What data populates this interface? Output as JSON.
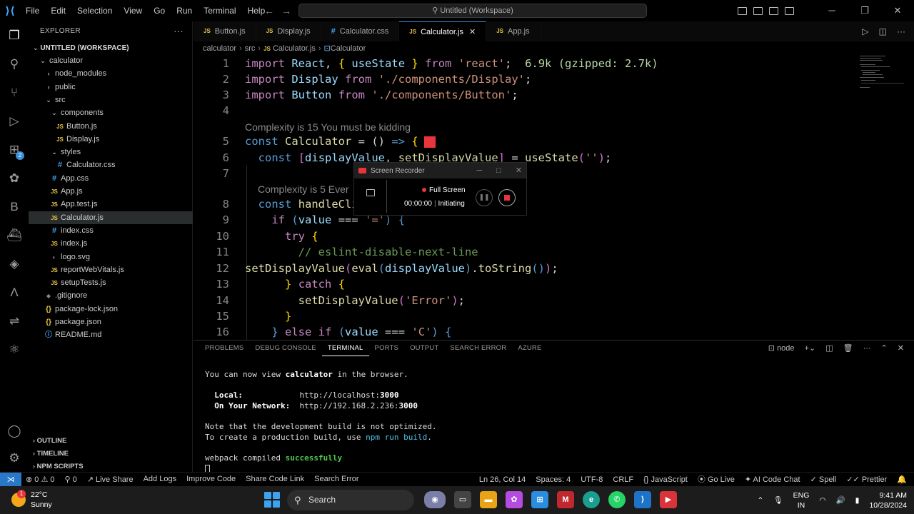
{
  "titlebar": {
    "menus": [
      "File",
      "Edit",
      "Selection",
      "View",
      "Go",
      "Run",
      "Terminal",
      "Help"
    ],
    "search": "Untitled (Workspace)"
  },
  "explorer": {
    "title": "EXPLORER",
    "workspace": "UNTITLED (WORKSPACE)",
    "items": [
      {
        "label": "calculator",
        "icon": "chevron-down",
        "depth": 1
      },
      {
        "label": "node_modules",
        "icon": "chevron-right",
        "depth": 2
      },
      {
        "label": "public",
        "icon": "chevron-right",
        "depth": 2
      },
      {
        "label": "src",
        "icon": "chevron-down",
        "depth": 2
      },
      {
        "label": "components",
        "icon": "chevron-down",
        "depth": 3
      },
      {
        "label": "Button.js",
        "icon": "js",
        "depth": 4
      },
      {
        "label": "Display.js",
        "icon": "js",
        "depth": 4
      },
      {
        "label": "styles",
        "icon": "chevron-down",
        "depth": 3
      },
      {
        "label": "Calculator.css",
        "icon": "css",
        "depth": 4
      },
      {
        "label": "App.css",
        "icon": "css",
        "depth": 3
      },
      {
        "label": "App.js",
        "icon": "js",
        "depth": 3
      },
      {
        "label": "App.test.js",
        "icon": "js",
        "depth": 3
      },
      {
        "label": "Calculator.js",
        "icon": "js",
        "depth": 3,
        "selected": true
      },
      {
        "label": "index.css",
        "icon": "css",
        "depth": 3
      },
      {
        "label": "index.js",
        "icon": "js",
        "depth": 3
      },
      {
        "label": "logo.svg",
        "icon": "svg",
        "depth": 3
      },
      {
        "label": "reportWebVitals.js",
        "icon": "js",
        "depth": 3
      },
      {
        "label": "setupTests.js",
        "icon": "js",
        "depth": 3
      },
      {
        "label": ".gitignore",
        "icon": "git",
        "depth": 2
      },
      {
        "label": "package-lock.json",
        "icon": "json",
        "depth": 2
      },
      {
        "label": "package.json",
        "icon": "json",
        "depth": 2
      },
      {
        "label": "README.md",
        "icon": "info",
        "depth": 2
      }
    ],
    "sections": [
      "OUTLINE",
      "TIMELINE",
      "NPM SCRIPTS"
    ]
  },
  "tabs": [
    {
      "label": "Button.js",
      "type": "js"
    },
    {
      "label": "Display.js",
      "type": "js"
    },
    {
      "label": "Calculator.css",
      "type": "css"
    },
    {
      "label": "Calculator.js",
      "type": "js",
      "active": true
    },
    {
      "label": "App.js",
      "type": "js"
    }
  ],
  "breadcrumb": {
    "a": "calculator",
    "b": "src",
    "c": "Calculator.js",
    "d": "Calculator"
  },
  "code": {
    "codelens1": "Complexity is 15 You must be kidding",
    "codelens2": "Complexity is 5 Ever",
    "size_hint": "6.9k (gzipped: 2.7k)",
    "line_numbers": [
      "1",
      "2",
      "3",
      "4",
      "5",
      "6",
      "7",
      "8",
      "9",
      "10",
      "11",
      "12",
      "13",
      "14",
      "15",
      "16"
    ]
  },
  "recorder": {
    "title": "Screen Recorder",
    "mode": "Full Screen",
    "time": "00:00:00",
    "state": "Initiating"
  },
  "panel": {
    "tabs": [
      "PROBLEMS",
      "DEBUG CONSOLE",
      "TERMINAL",
      "PORTS",
      "OUTPUT",
      "SEARCH ERROR",
      "AZURE"
    ],
    "active_tab": "TERMINAL",
    "shell": "node",
    "terminal": {
      "l1a": "You can now view ",
      "l1b": "calculator",
      "l1c": " in the browser.",
      "local_label": "  Local:            ",
      "local_url": "http://localhost:",
      "local_port": "3000",
      "net_label": "  On Your Network:  ",
      "net_url": "http://192.168.2.236:",
      "net_port": "3000",
      "note1": "Note that the development build is not optimized.",
      "note2a": "To create a production build, use ",
      "note2b": "npm run build",
      "note2c": ".",
      "wp_a": "webpack compiled ",
      "wp_b": "successfully"
    }
  },
  "statusbar": {
    "problems": "⊗ 0 ⚠ 0",
    "ports": "⚲ 0",
    "left": [
      "Live Share",
      "Add Logs",
      "Improve Code",
      "Share Code Link",
      "Search Error"
    ],
    "right": [
      "Ln 26, Col 14",
      "Spaces: 4",
      "UTF-8",
      "CRLF",
      "{} JavaScript",
      "Go Live",
      "AI Code Chat",
      "Spell",
      "Prettier"
    ]
  },
  "taskbar": {
    "temp": "22°C",
    "weather": "Sunny",
    "weather_badge": "1",
    "search": "Search",
    "lang1": "ENG",
    "lang2": "IN",
    "time": "9:41 AM",
    "date": "10/28/2024"
  }
}
